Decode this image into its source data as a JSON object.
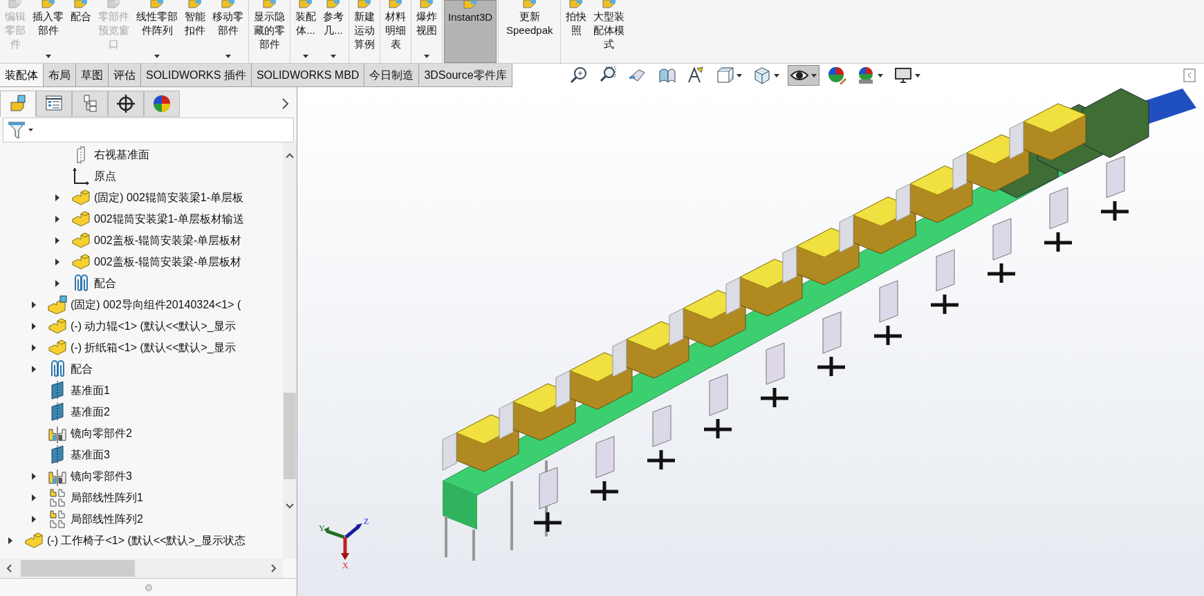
{
  "toolbar": {
    "groups": [
      {
        "buttons": [
          {
            "label": "编辑零部件",
            "disabled": true,
            "dropdown": false,
            "selected": false
          },
          {
            "label": "插入零部件",
            "disabled": false,
            "dropdown": true,
            "selected": false
          },
          {
            "label": "配合",
            "disabled": false,
            "dropdown": false,
            "selected": false
          },
          {
            "label": "零部件预览窗口",
            "disabled": true,
            "dropdown": false,
            "selected": false
          },
          {
            "label": "线性零部件阵列",
            "disabled": false,
            "dropdown": true,
            "selected": false
          },
          {
            "label": "智能扣件",
            "disabled": false,
            "dropdown": false,
            "selected": false
          },
          {
            "label": "移动零部件",
            "disabled": false,
            "dropdown": true,
            "selected": false
          }
        ]
      },
      {
        "buttons": [
          {
            "label": "显示隐藏的零部件",
            "disabled": false,
            "dropdown": false,
            "selected": false
          }
        ]
      },
      {
        "buttons": [
          {
            "label": "装配体...",
            "disabled": false,
            "dropdown": true,
            "selected": false
          },
          {
            "label": "参考几...",
            "disabled": false,
            "dropdown": true,
            "selected": false
          }
        ]
      },
      {
        "buttons": [
          {
            "label": "新建运动算例",
            "disabled": false,
            "dropdown": false,
            "selected": false
          }
        ]
      },
      {
        "buttons": [
          {
            "label": "材料明细表",
            "disabled": false,
            "dropdown": false,
            "selected": false
          }
        ]
      },
      {
        "buttons": [
          {
            "label": "爆炸视图",
            "disabled": false,
            "dropdown": true,
            "selected": false
          }
        ]
      },
      {
        "buttons": [
          {
            "label": "Instant3D",
            "disabled": false,
            "dropdown": false,
            "selected": true
          }
        ]
      },
      {
        "buttons": [
          {
            "label": "更新 Speedpak",
            "disabled": false,
            "dropdown": false,
            "selected": false
          }
        ]
      },
      {
        "buttons": [
          {
            "label": "拍快照",
            "disabled": false,
            "dropdown": false,
            "selected": false
          },
          {
            "label": "大型装配体模式",
            "disabled": false,
            "dropdown": false,
            "selected": false
          }
        ]
      }
    ]
  },
  "tabs": [
    {
      "label": "装配体",
      "selected": true
    },
    {
      "label": "布局",
      "selected": false
    },
    {
      "label": "草图",
      "selected": false
    },
    {
      "label": "评估",
      "selected": false
    },
    {
      "label": "SOLIDWORKS 插件",
      "selected": false
    },
    {
      "label": "SOLIDWORKS MBD",
      "selected": false
    },
    {
      "label": "今日制造",
      "selected": false
    },
    {
      "label": "3DSource零件库",
      "selected": false
    }
  ],
  "panel_tabs": [
    {
      "kind": "feature",
      "selected": true
    },
    {
      "kind": "property",
      "selected": false
    },
    {
      "kind": "config",
      "selected": false
    },
    {
      "kind": "dim",
      "selected": false
    },
    {
      "kind": "display",
      "selected": false
    }
  ],
  "tree": [
    {
      "children": [
        {
          "children": [
            {
              "kind": "plane-outline",
              "label": "右视基准面"
            },
            {
              "kind": "origin",
              "label": "原点"
            },
            {
              "kind": "part",
              "label": "(固定) 002辊筒安装梁1-单层板",
              "expanded": false
            },
            {
              "kind": "part",
              "label": "002辊筒安装梁1-单层板材输送",
              "expanded": false
            },
            {
              "kind": "part",
              "label": "002盖板-辊筒安装梁-单层板材",
              "expanded": false
            },
            {
              "kind": "part",
              "label": "002盖板-辊筒安装梁-单层板材",
              "expanded": false
            },
            {
              "kind": "mates",
              "label": "配合",
              "expanded": false
            }
          ]
        },
        {
          "kind": "assembly",
          "label": "(固定) 002导向组件20140324<1> (",
          "expanded": false
        },
        {
          "kind": "part",
          "label": "(-) 动力辊<1> (默认<<默认>_显示",
          "expanded": false
        },
        {
          "kind": "part",
          "label": "(-) 折纸箱<1> (默认<<默认>_显示",
          "expanded": false
        },
        {
          "kind": "mates",
          "label": "配合",
          "expanded": false
        },
        {
          "kind": "plane",
          "label": "基准面1"
        },
        {
          "kind": "plane",
          "label": "基准面2"
        },
        {
          "kind": "mirror",
          "label": "镜向零部件2"
        },
        {
          "kind": "plane",
          "label": "基准面3"
        },
        {
          "kind": "mirror",
          "label": "镜向零部件3",
          "expanded": false
        },
        {
          "kind": "pattern",
          "label": "局部线性阵列1",
          "expanded": false
        },
        {
          "kind": "pattern",
          "label": "局部线性阵列2",
          "expanded": false
        }
      ]
    },
    {
      "kind": "part",
      "label": "(-) 工作椅子<1> (默认<<默认>_显示状态",
      "expanded": false
    }
  ],
  "view_toolbar": [
    {
      "kind": "zoom-fit",
      "pressed": false,
      "dropdown": false
    },
    {
      "kind": "zoom-area",
      "pressed": false,
      "dropdown": false
    },
    {
      "kind": "previous",
      "pressed": false,
      "dropdown": false
    },
    {
      "kind": "section",
      "pressed": false,
      "dropdown": false
    },
    {
      "kind": "annotation",
      "pressed": false,
      "dropdown": false
    },
    {
      "kind": "orientation",
      "pressed": false,
      "dropdown": true
    },
    {
      "kind": "display-style",
      "pressed": false,
      "dropdown": true
    },
    {
      "kind": "hide-show",
      "pressed": true,
      "dropdown": true
    },
    {
      "kind": "appearance",
      "pressed": false,
      "dropdown": false
    },
    {
      "kind": "scene",
      "pressed": false,
      "dropdown": true
    },
    {
      "kind": "monitor",
      "pressed": false,
      "dropdown": true
    }
  ],
  "triad": {
    "x_label": "X",
    "y_label": "Y",
    "z_label": "Z"
  }
}
